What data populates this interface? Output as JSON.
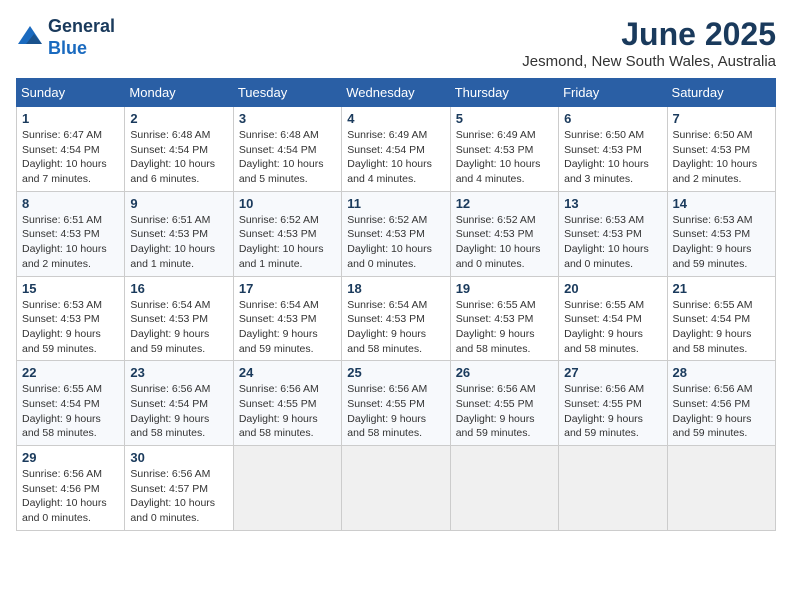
{
  "logo": {
    "line1": "General",
    "line2": "Blue"
  },
  "title": "June 2025",
  "location": "Jesmond, New South Wales, Australia",
  "days_of_week": [
    "Sunday",
    "Monday",
    "Tuesday",
    "Wednesday",
    "Thursday",
    "Friday",
    "Saturday"
  ],
  "weeks": [
    [
      {
        "day": "1",
        "info": "Sunrise: 6:47 AM\nSunset: 4:54 PM\nDaylight: 10 hours\nand 7 minutes."
      },
      {
        "day": "2",
        "info": "Sunrise: 6:48 AM\nSunset: 4:54 PM\nDaylight: 10 hours\nand 6 minutes."
      },
      {
        "day": "3",
        "info": "Sunrise: 6:48 AM\nSunset: 4:54 PM\nDaylight: 10 hours\nand 5 minutes."
      },
      {
        "day": "4",
        "info": "Sunrise: 6:49 AM\nSunset: 4:54 PM\nDaylight: 10 hours\nand 4 minutes."
      },
      {
        "day": "5",
        "info": "Sunrise: 6:49 AM\nSunset: 4:53 PM\nDaylight: 10 hours\nand 4 minutes."
      },
      {
        "day": "6",
        "info": "Sunrise: 6:50 AM\nSunset: 4:53 PM\nDaylight: 10 hours\nand 3 minutes."
      },
      {
        "day": "7",
        "info": "Sunrise: 6:50 AM\nSunset: 4:53 PM\nDaylight: 10 hours\nand 2 minutes."
      }
    ],
    [
      {
        "day": "8",
        "info": "Sunrise: 6:51 AM\nSunset: 4:53 PM\nDaylight: 10 hours\nand 2 minutes."
      },
      {
        "day": "9",
        "info": "Sunrise: 6:51 AM\nSunset: 4:53 PM\nDaylight: 10 hours\nand 1 minute."
      },
      {
        "day": "10",
        "info": "Sunrise: 6:52 AM\nSunset: 4:53 PM\nDaylight: 10 hours\nand 1 minute."
      },
      {
        "day": "11",
        "info": "Sunrise: 6:52 AM\nSunset: 4:53 PM\nDaylight: 10 hours\nand 0 minutes."
      },
      {
        "day": "12",
        "info": "Sunrise: 6:52 AM\nSunset: 4:53 PM\nDaylight: 10 hours\nand 0 minutes."
      },
      {
        "day": "13",
        "info": "Sunrise: 6:53 AM\nSunset: 4:53 PM\nDaylight: 10 hours\nand 0 minutes."
      },
      {
        "day": "14",
        "info": "Sunrise: 6:53 AM\nSunset: 4:53 PM\nDaylight: 9 hours\nand 59 minutes."
      }
    ],
    [
      {
        "day": "15",
        "info": "Sunrise: 6:53 AM\nSunset: 4:53 PM\nDaylight: 9 hours\nand 59 minutes."
      },
      {
        "day": "16",
        "info": "Sunrise: 6:54 AM\nSunset: 4:53 PM\nDaylight: 9 hours\nand 59 minutes."
      },
      {
        "day": "17",
        "info": "Sunrise: 6:54 AM\nSunset: 4:53 PM\nDaylight: 9 hours\nand 59 minutes."
      },
      {
        "day": "18",
        "info": "Sunrise: 6:54 AM\nSunset: 4:53 PM\nDaylight: 9 hours\nand 58 minutes."
      },
      {
        "day": "19",
        "info": "Sunrise: 6:55 AM\nSunset: 4:53 PM\nDaylight: 9 hours\nand 58 minutes."
      },
      {
        "day": "20",
        "info": "Sunrise: 6:55 AM\nSunset: 4:54 PM\nDaylight: 9 hours\nand 58 minutes."
      },
      {
        "day": "21",
        "info": "Sunrise: 6:55 AM\nSunset: 4:54 PM\nDaylight: 9 hours\nand 58 minutes."
      }
    ],
    [
      {
        "day": "22",
        "info": "Sunrise: 6:55 AM\nSunset: 4:54 PM\nDaylight: 9 hours\nand 58 minutes."
      },
      {
        "day": "23",
        "info": "Sunrise: 6:56 AM\nSunset: 4:54 PM\nDaylight: 9 hours\nand 58 minutes."
      },
      {
        "day": "24",
        "info": "Sunrise: 6:56 AM\nSunset: 4:55 PM\nDaylight: 9 hours\nand 58 minutes."
      },
      {
        "day": "25",
        "info": "Sunrise: 6:56 AM\nSunset: 4:55 PM\nDaylight: 9 hours\nand 58 minutes."
      },
      {
        "day": "26",
        "info": "Sunrise: 6:56 AM\nSunset: 4:55 PM\nDaylight: 9 hours\nand 59 minutes."
      },
      {
        "day": "27",
        "info": "Sunrise: 6:56 AM\nSunset: 4:55 PM\nDaylight: 9 hours\nand 59 minutes."
      },
      {
        "day": "28",
        "info": "Sunrise: 6:56 AM\nSunset: 4:56 PM\nDaylight: 9 hours\nand 59 minutes."
      }
    ],
    [
      {
        "day": "29",
        "info": "Sunrise: 6:56 AM\nSunset: 4:56 PM\nDaylight: 10 hours\nand 0 minutes."
      },
      {
        "day": "30",
        "info": "Sunrise: 6:56 AM\nSunset: 4:57 PM\nDaylight: 10 hours\nand 0 minutes."
      },
      {
        "day": "",
        "info": ""
      },
      {
        "day": "",
        "info": ""
      },
      {
        "day": "",
        "info": ""
      },
      {
        "day": "",
        "info": ""
      },
      {
        "day": "",
        "info": ""
      }
    ]
  ]
}
